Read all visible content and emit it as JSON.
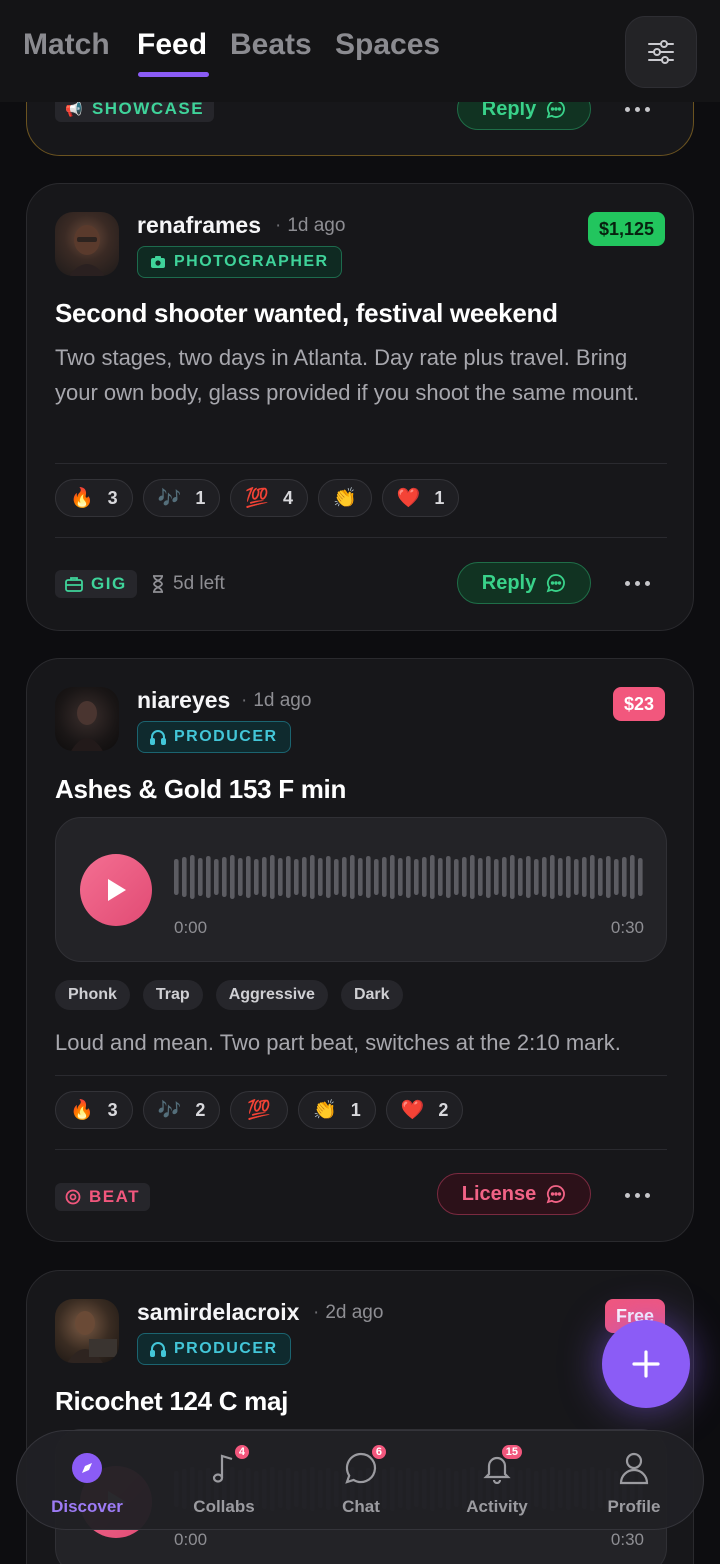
{
  "header": {
    "tabs": [
      {
        "label": "Match",
        "active": false
      },
      {
        "label": "Feed",
        "active": true
      },
      {
        "label": "Beats",
        "active": false
      },
      {
        "label": "Spaces",
        "active": false
      }
    ],
    "filter_icon": "sliders-icon"
  },
  "showcase_card": {
    "type_label": "SHOWCASE",
    "reply_label": "Reply"
  },
  "gig_card": {
    "username": "renaframes",
    "time": "1d ago",
    "role": "PHOTOGRAPHER",
    "price": "$1,125",
    "title": "Second shooter wanted, festival weekend",
    "body": "Two stages, two days in Atlanta. Day rate plus travel. Bring your own body, glass provided if you shoot the same mount.",
    "reactions": [
      {
        "emoji": "🔥",
        "count": "3"
      },
      {
        "emoji": "🎶",
        "count": "1"
      },
      {
        "emoji": "💯",
        "count": "4"
      },
      {
        "emoji": "👏",
        "count": ""
      },
      {
        "emoji": "❤️",
        "count": "1"
      }
    ],
    "type_label": "GIG",
    "time_left": "5d left",
    "reply_label": "Reply"
  },
  "beat_card": {
    "username": "niareyes",
    "time": "1d ago",
    "role": "PRODUCER",
    "price": "$23",
    "title": "Ashes & Gold 153 F min",
    "player": {
      "start": "0:00",
      "end": "0:30"
    },
    "tags": [
      "Phonk",
      "Trap",
      "Aggressive",
      "Dark"
    ],
    "body": "Loud and mean. Two part beat, switches at the 2:10 mark.",
    "reactions": [
      {
        "emoji": "🔥",
        "count": "3"
      },
      {
        "emoji": "🎶",
        "count": "2"
      },
      {
        "emoji": "💯",
        "count": ""
      },
      {
        "emoji": "👏",
        "count": "1"
      },
      {
        "emoji": "❤️",
        "count": "2"
      }
    ],
    "type_label": "BEAT",
    "license_label": "License"
  },
  "beat_card_2": {
    "username": "samirdelacroix",
    "time": "2d ago",
    "role": "PRODUCER",
    "price": "Free",
    "title": "Ricochet 124 C maj",
    "player": {
      "start": "0:00",
      "end": "0:30"
    }
  },
  "bottom_nav": [
    {
      "label": "Discover",
      "icon": "compass-icon",
      "badge": "",
      "active": true
    },
    {
      "label": "Collabs",
      "icon": "music-note-icon",
      "badge": "4",
      "active": false
    },
    {
      "label": "Chat",
      "icon": "chat-bubble-icon",
      "badge": "6",
      "active": false
    },
    {
      "label": "Activity",
      "icon": "bell-icon",
      "badge": "15",
      "active": false
    },
    {
      "label": "Profile",
      "icon": "person-icon",
      "badge": "",
      "active": false
    }
  ],
  "colors": {
    "accent": "#8b5cf6",
    "gig_green": "#22c55e",
    "beat_pink": "#f2577d",
    "producer_teal": "#43c6d8"
  }
}
